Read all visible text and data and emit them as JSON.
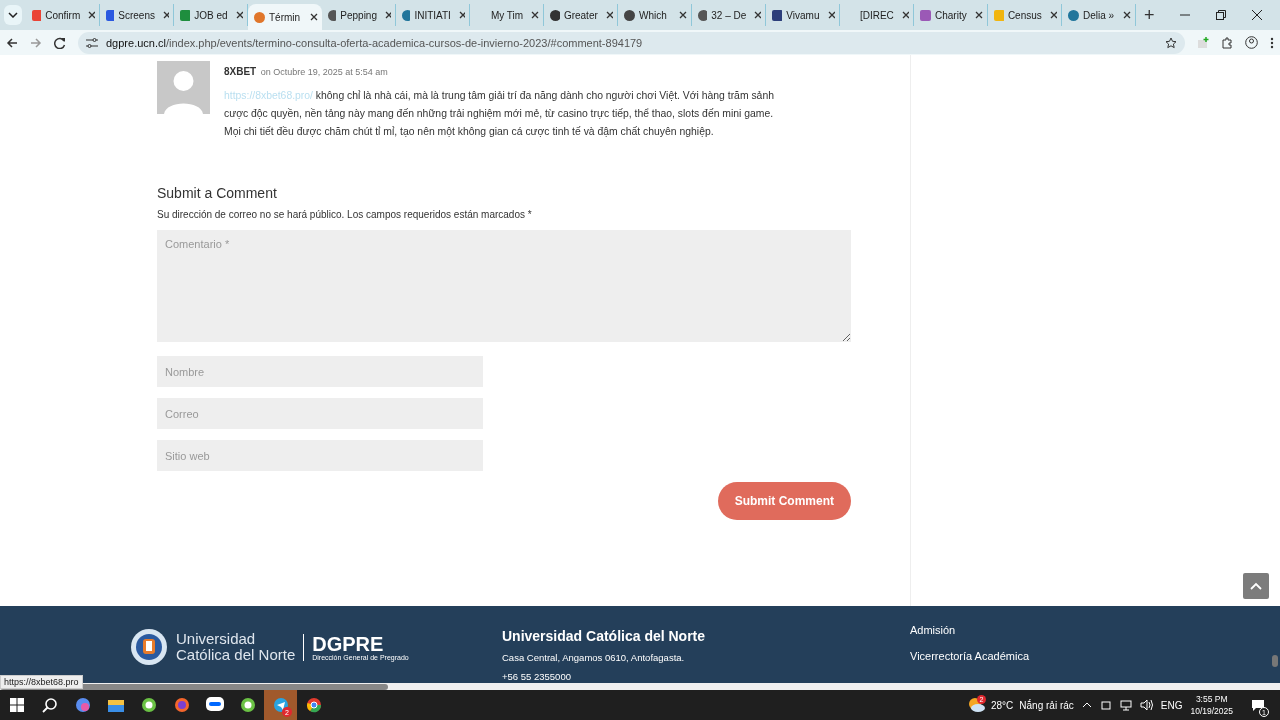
{
  "tabs": [
    {
      "title": "Confirm",
      "selected": false
    },
    {
      "title": "Screens",
      "selected": false
    },
    {
      "title": "JOB ed",
      "selected": false
    },
    {
      "title": "Términ",
      "selected": true
    },
    {
      "title": "Pepping",
      "selected": false
    },
    {
      "title": "INITIATI",
      "selected": false
    },
    {
      "title": "My Tim",
      "selected": false
    },
    {
      "title": "Greater",
      "selected": false
    },
    {
      "title": "Which",
      "selected": false
    },
    {
      "title": "32 – De",
      "selected": false
    },
    {
      "title": "Vivamu",
      "selected": false
    },
    {
      "title": "[DIREC",
      "selected": false
    },
    {
      "title": "Charity",
      "selected": false
    },
    {
      "title": "Census",
      "selected": false
    },
    {
      "title": "Delia »",
      "selected": false
    }
  ],
  "new_tab": "+",
  "address": {
    "domain": "dgpre.ucn.cl",
    "path": "/index.php/events/termino-consulta-oferta-academica-cursos-de-invierno-2023/#comment-894179"
  },
  "comment": {
    "author": "8XBET",
    "date": "on Octubre 19, 2025 at 5:54 am",
    "link": "https://8xbet68.pro/",
    "text": "không chỉ là nhà cái, mà là trung tâm giải trí đa năng dành cho người chơi Việt. Với hàng trăm sảnh cược độc quyền, nền tảng này mang đến những trải nghiệm mới mẻ, từ casino trực tiếp, thể thao, slots đến mini game. Mọi chi tiết đều được chăm chút tỉ mỉ, tạo nên một không gian cá cược tinh tế và đậm chất chuyên nghiệp."
  },
  "form": {
    "title": "Submit a Comment",
    "note": "Su dirección de correo no se hará público. Los campos requeridos están marcados *",
    "comment_placeholder": "Comentario *",
    "field_placeholders": [
      "Nombre",
      "Correo",
      "Sitio web"
    ],
    "submit": "Submit Comment"
  },
  "footer": {
    "logo_line1": "Universidad",
    "logo_line2": "Católica del Norte",
    "brand": "DGPRE",
    "brand_sub": "Dirección General de Pregrado",
    "heading": "Universidad Católica del Norte",
    "address": "Casa Central, Angamos 0610, Antofagasta.",
    "phone": "+56 55 2355000",
    "links": [
      "Admisión",
      "Vicerrectoría Académica"
    ]
  },
  "status_url": "https://8xbet68.pro",
  "taskbar": {
    "apps": [
      {
        "kind": "copilot",
        "selected": false
      },
      {
        "kind": "folder",
        "selected": false
      },
      {
        "kind": "green",
        "selected": false
      },
      {
        "kind": "firefox",
        "selected": false
      },
      {
        "kind": "zalo",
        "selected": false
      },
      {
        "kind": "green",
        "selected": false
      },
      {
        "kind": "telegram",
        "selected": true,
        "badge": "2"
      },
      {
        "kind": "chrome",
        "selected": false
      }
    ],
    "weather_badge": "2",
    "temperature": "28°C",
    "weather": "Nắng rải rác",
    "language": "ENG",
    "time": "3:55 PM",
    "date": "10/19/2025",
    "notifications": "1"
  }
}
